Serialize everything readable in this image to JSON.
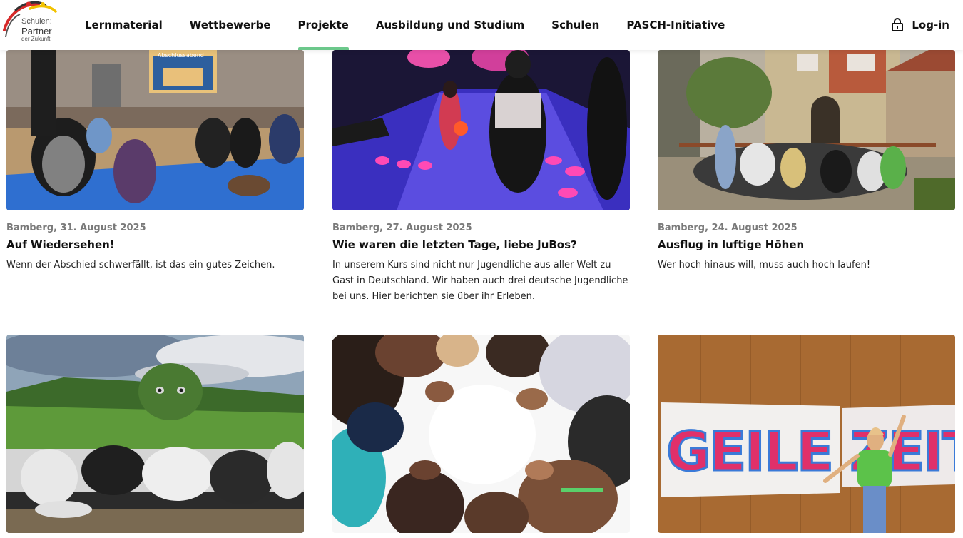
{
  "logo": {
    "line1": "Schulen:",
    "line2": "Partner",
    "line3": "der Zukunft"
  },
  "nav": {
    "items": [
      {
        "label": "Lernmaterial"
      },
      {
        "label": "Wettbewerbe"
      },
      {
        "label": "Projekte",
        "active": true
      },
      {
        "label": "Ausbildung und Studium"
      },
      {
        "label": "Schulen"
      },
      {
        "label": "PASCH-Initiative"
      }
    ],
    "login_label": "Log-in"
  },
  "cards": [
    {
      "meta": "Bamberg, 31. August 2025",
      "title": "Auf Wiedersehen!",
      "desc": "Wenn der Abschied schwerfällt, ist das ein gutes Zeichen.",
      "image_label": "Abschlussabend"
    },
    {
      "meta": "Bamberg, 27. August 2025",
      "title": "Wie waren die letzten Tage, liebe JuBos?",
      "desc": "In unserem Kurs sind nicht nur Jugendliche aus aller Welt zu Gast in Deutschland. Wir haben auch drei deutsche Jugendliche bei uns. Hier berichten sie über ihr Erleben."
    },
    {
      "meta": "Bamberg, 24. August 2025",
      "title": "Ausflug in luftige Höhen",
      "desc": "Wer hoch hinaus will, muss auch hoch laufen!"
    },
    {},
    {},
    {
      "image_label": "GEILE ZEIT"
    }
  ],
  "colors": {
    "accent": "#6cc88b",
    "meta": "#7a7a7a"
  }
}
